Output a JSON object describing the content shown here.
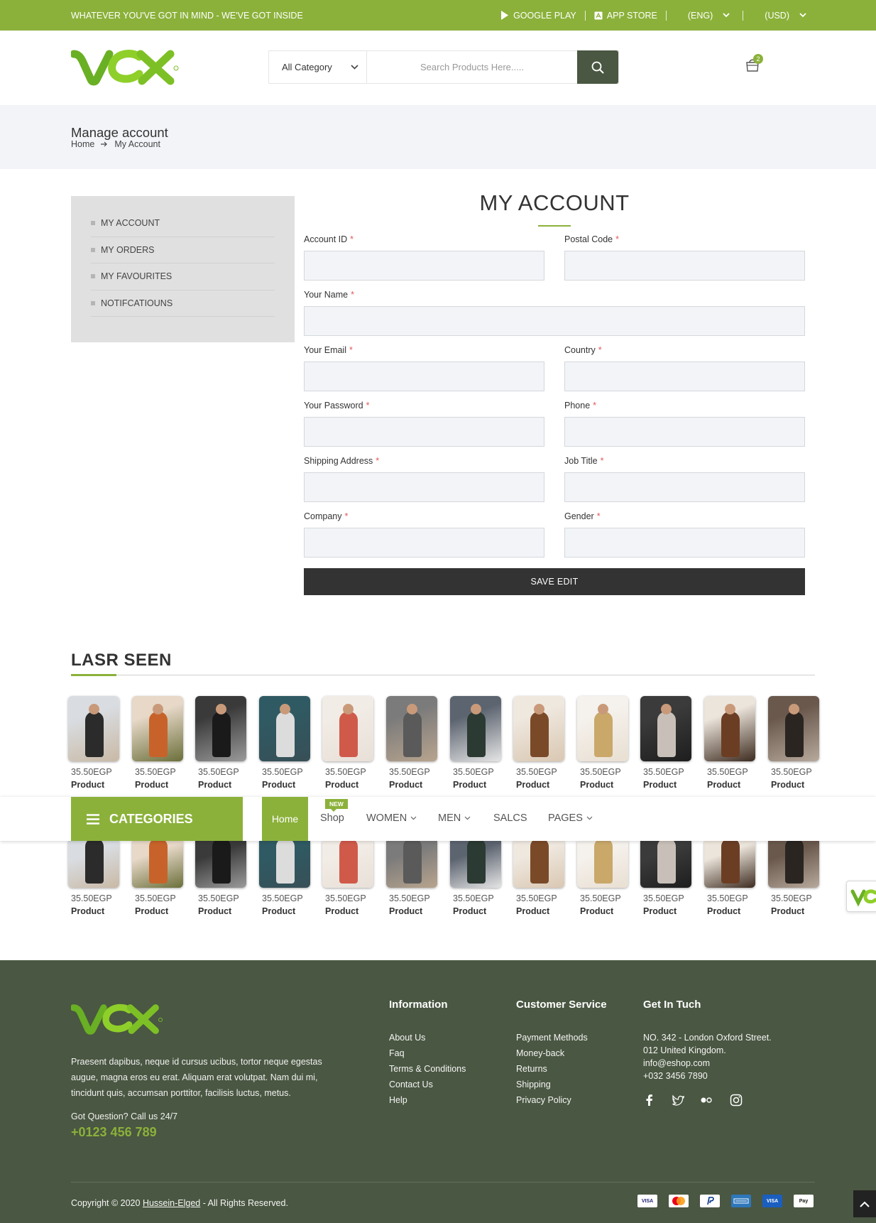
{
  "colors": {
    "brand_green": "#8bb13a",
    "footer_bg": "#4a5742",
    "button_dark": "#333333",
    "input_bg": "#f2f4f8"
  },
  "topbar": {
    "promo": "WHATEVER YOU'VE GOT IN MIND - WE'VE GOT INSIDE",
    "google_play": "GOOGLE PLAY",
    "app_store": "APP STORE",
    "language": "(ENG)",
    "currency": "(USD)"
  },
  "header": {
    "category_select": "All Category",
    "search_placeholder": "Search Products Here.....",
    "cart_count": "2"
  },
  "page": {
    "title": "Manage account",
    "breadcrumb": [
      "Home",
      "My Account"
    ]
  },
  "sidebar": {
    "items": [
      "MY ACCOUNT",
      "MY ORDERS",
      "MY FAVOURITES",
      "NOTIFCATIOUNS"
    ]
  },
  "form": {
    "title": "MY ACCOUNT",
    "required_mark": "*",
    "fields": {
      "account_id": "Account ID",
      "postal_code": "Postal Code",
      "name": "Your Name",
      "email": "Your Email",
      "country": "Country",
      "password": "Your Password",
      "phone": "Phone",
      "shipping_address": "Shipping Address",
      "job_title": "Job Title",
      "company": "Company",
      "gender": "Gender"
    },
    "submit": "SAVE EDIT"
  },
  "last_seen": {
    "title": "LASR SEEN",
    "price": "35.50EGP",
    "name": "Product"
  },
  "nav": {
    "categories": "CATEGORIES",
    "home": "Home",
    "shop": "Shop",
    "new_badge": "NEW",
    "women": "WOMEN",
    "men": "MEN",
    "sales": "SALCS",
    "pages": "PAGES"
  },
  "footer": {
    "description": "Praesent dapibus, neque id cursus ucibus, tortor neque egestas augue, magna eros eu erat. Aliquam erat volutpat. Nam dui mi, tincidunt quis, accumsan porttitor, facilisis luctus, metus.",
    "question": "Got Question? Call us 24/7",
    "phone": "+0123 456 789",
    "information": {
      "title": "Information",
      "links": [
        "About Us",
        "Faq",
        "Terms & Conditions",
        "Contact Us",
        "Help"
      ]
    },
    "customer_service": {
      "title": "Customer Service",
      "links": [
        "Payment Methods",
        "Money-back",
        "Returns",
        "Shipping",
        "Privacy Policy"
      ]
    },
    "get_in_touch": {
      "title": "Get In Tuch",
      "lines": [
        "NO. 342 - London Oxford Street.",
        "012 United Kingdom.",
        "info@eshop.com",
        "+032 3456 7890"
      ]
    },
    "copyright_prefix": "Copyright © 2020",
    "copyright_author": "Hussein-Elged",
    "copyright_suffix": "- All Rights Reserved.",
    "payments": [
      "VISA",
      "MasterCard",
      "PayPal",
      "AmEx",
      "VISA",
      "Pay"
    ]
  }
}
